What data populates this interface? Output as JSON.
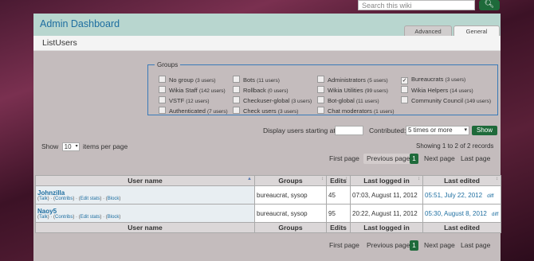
{
  "search": {
    "placeholder": "Search this wiki"
  },
  "header": {
    "title": "Admin Dashboard",
    "tabs": [
      {
        "label": "Advanced"
      },
      {
        "label": "General"
      }
    ]
  },
  "page": {
    "title": "ListUsers"
  },
  "groups": {
    "legend": "Groups",
    "items": [
      {
        "name": "No group",
        "count": "(3 users)",
        "checked": false
      },
      {
        "name": "Bots",
        "count": "(11 users)",
        "checked": false
      },
      {
        "name": "Administrators",
        "count": "(5 users)",
        "checked": false
      },
      {
        "name": "Bureaucrats",
        "count": "(3 users)",
        "checked": true
      },
      {
        "name": "Wikia Staff",
        "count": "(142 users)",
        "checked": false
      },
      {
        "name": "Rollback",
        "count": "(0 users)",
        "checked": false
      },
      {
        "name": "Wikia Utilities",
        "count": "(99 users)",
        "checked": false
      },
      {
        "name": "Wikia Helpers",
        "count": "(14 users)",
        "checked": false
      },
      {
        "name": "VSTF",
        "count": "(12 users)",
        "checked": false
      },
      {
        "name": "Checkuser-global",
        "count": "(3 users)",
        "checked": false
      },
      {
        "name": "Bot-global",
        "count": "(11 users)",
        "checked": false
      },
      {
        "name": "Community Council",
        "count": "(149 users)",
        "checked": false
      },
      {
        "name": "Authenticated",
        "count": "(7 users)",
        "checked": false
      },
      {
        "name": "Check users",
        "count": "(3 users)",
        "checked": false
      },
      {
        "name": "Chat moderators",
        "count": "(1 users)",
        "checked": false
      }
    ]
  },
  "filters": {
    "display_label": "Display users starting at:",
    "display_value": "",
    "contributed_label": "Contributed:",
    "contributed_value": "5 times or more",
    "show_label": "Show"
  },
  "perpage": {
    "show": "Show",
    "value": "10",
    "suffix": "items per page"
  },
  "showing": {
    "text": "Showing 1 to 2 of 2 records"
  },
  "pager": {
    "first": "First page",
    "prev": "Previous page",
    "current": "1",
    "next": "Next page",
    "last": "Last page"
  },
  "table": {
    "headers": [
      "User name",
      "Groups",
      "Edits",
      "Last logged in",
      "Last edited"
    ],
    "rows": [
      {
        "user": "Johnzilla",
        "links": [
          "Talk",
          "Contribs",
          "Edit stats",
          "Block"
        ],
        "groups": "bureaucrat, sysop",
        "edits": "45",
        "last_login": "07:03, August 11, 2012",
        "last_edited": "05:51, July 22, 2012",
        "diff": "diff"
      },
      {
        "user": "Naoy5",
        "links": [
          "Talk",
          "Contribs",
          "Edit stats",
          "Block"
        ],
        "groups": "bureaucrat, sysop",
        "edits": "95",
        "last_login": "20:22, August 11, 2012",
        "last_edited": "05:30, August 8, 2012",
        "diff": "diff"
      }
    ]
  },
  "colors": {
    "accent": "#1e6a3a",
    "link": "#1e6ea0",
    "header_bg": "#b8d6cf",
    "fieldset_border": "#3a7ab8"
  },
  "icons": {
    "search_button": "search-icon",
    "sort": "sort-arrows-icon",
    "dropdown": "chevron-down-icon",
    "checkbox": "checkbox-icon"
  }
}
